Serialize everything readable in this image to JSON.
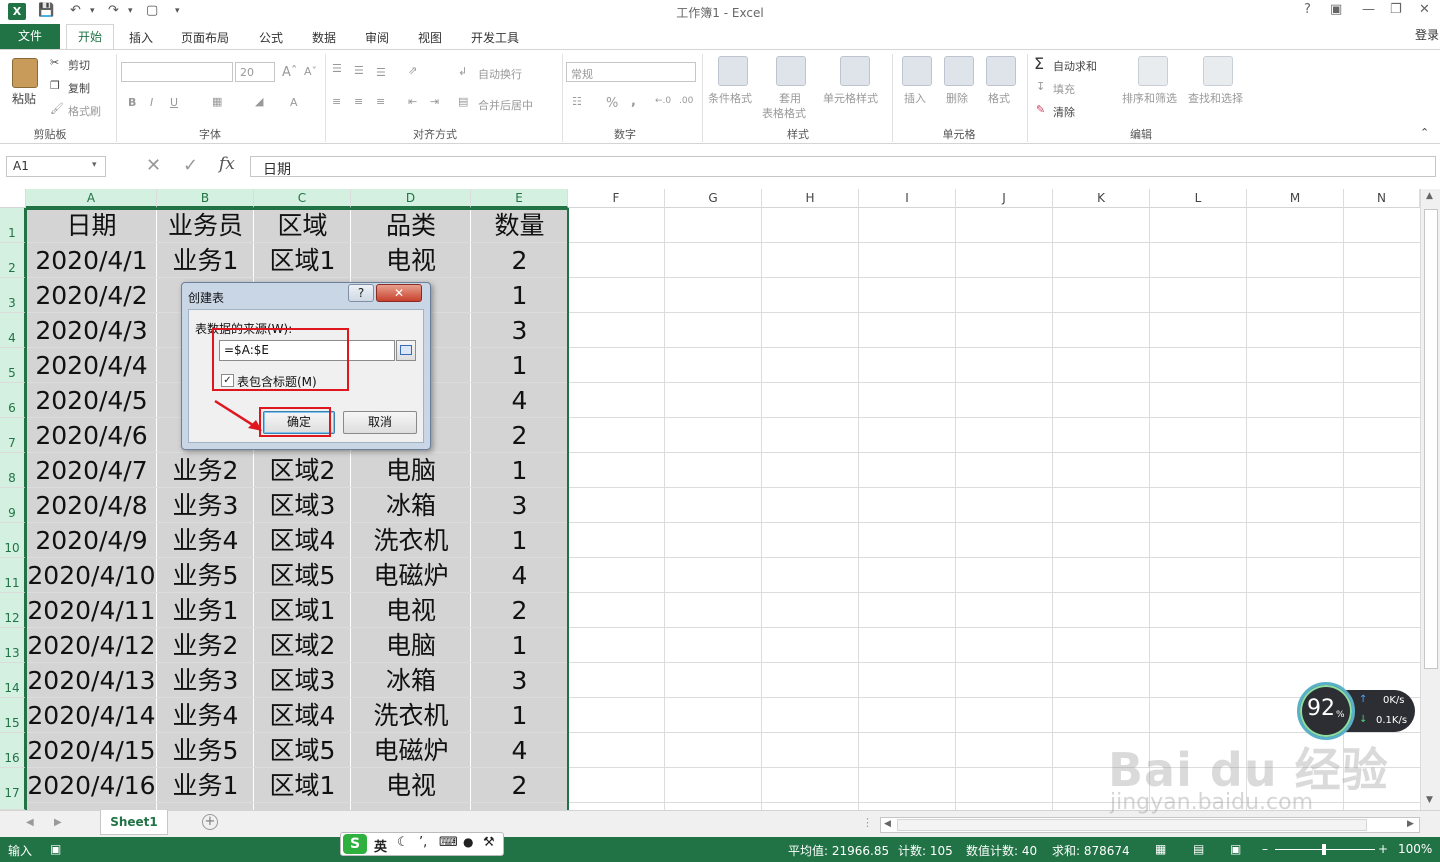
{
  "window": {
    "title": "工作簿1 - Excel",
    "login": "登录",
    "help": "?"
  },
  "tabs": [
    "文件",
    "开始",
    "插入",
    "页面布局",
    "公式",
    "数据",
    "审阅",
    "视图",
    "开发工具"
  ],
  "ribbon": {
    "clipboard": {
      "paste": "粘贴",
      "cut": "剪切",
      "copy": "复制",
      "format_painter": "格式刷",
      "label": "剪贴板"
    },
    "font": {
      "size": "20",
      "bold": "B",
      "italic": "I",
      "underline": "U",
      "label": "字体"
    },
    "align": {
      "wrap": "自动换行",
      "merge": "合并后居中",
      "label": "对齐方式"
    },
    "number": {
      "format": "常规",
      "percent": "%",
      "comma": ",",
      "label": "数字"
    },
    "styles": {
      "conditional": "条件格式",
      "table_a": "套用",
      "table_b": "表格格式",
      "cell_styles": "单元格样式",
      "label": "样式"
    },
    "cells": {
      "insert": "插入",
      "delete": "删除",
      "format": "格式",
      "label": "单元格"
    },
    "editing": {
      "autosum": "自动求和",
      "fill": "填充",
      "clear": "清除",
      "sort": "排序和筛选",
      "find": "查找和选择",
      "label": "编辑"
    }
  },
  "formula_bar": {
    "name_box": "A1",
    "fx": "fx",
    "value": "日期"
  },
  "columns": [
    "A",
    "B",
    "C",
    "D",
    "E",
    "F",
    "G",
    "H",
    "I",
    "J",
    "K",
    "L",
    "M",
    "N"
  ],
  "rows": [
    "1",
    "2",
    "3",
    "4",
    "5",
    "6",
    "7",
    "8",
    "9",
    "10",
    "11",
    "12",
    "13",
    "14",
    "15",
    "16",
    "17"
  ],
  "table": {
    "header": [
      "日期",
      "业务员",
      "区域",
      "品类",
      "数量"
    ],
    "rows": [
      [
        "2020/4/1",
        "业务1",
        "区域1",
        "电视",
        "2"
      ],
      [
        "2020/4/2",
        "",
        "",
        "",
        "1"
      ],
      [
        "2020/4/3",
        "",
        "",
        "",
        "3"
      ],
      [
        "2020/4/4",
        "",
        "",
        "",
        "1"
      ],
      [
        "2020/4/5",
        "",
        "",
        "",
        "4"
      ],
      [
        "2020/4/6",
        "",
        "",
        "",
        "2"
      ],
      [
        "2020/4/7",
        "业务2",
        "区域2",
        "电脑",
        "1"
      ],
      [
        "2020/4/8",
        "业务3",
        "区域3",
        "冰箱",
        "3"
      ],
      [
        "2020/4/9",
        "业务4",
        "区域4",
        "洗衣机",
        "1"
      ],
      [
        "2020/4/10",
        "业务5",
        "区域5",
        "电磁炉",
        "4"
      ],
      [
        "2020/4/11",
        "业务1",
        "区域1",
        "电视",
        "2"
      ],
      [
        "2020/4/12",
        "业务2",
        "区域2",
        "电脑",
        "1"
      ],
      [
        "2020/4/13",
        "业务3",
        "区域3",
        "冰箱",
        "3"
      ],
      [
        "2020/4/14",
        "业务4",
        "区域4",
        "洗衣机",
        "1"
      ],
      [
        "2020/4/15",
        "业务5",
        "区域5",
        "电磁炉",
        "4"
      ],
      [
        "2020/4/16",
        "业务1",
        "区域1",
        "电视",
        "2"
      ]
    ]
  },
  "dialog": {
    "title": "创建表",
    "help": "?",
    "close": "✕",
    "source_label": "表数据的来源(W):",
    "range": "=$A:$E",
    "has_header": "表包含标题(M)",
    "ok": "确定",
    "cancel": "取消"
  },
  "sheet": {
    "tab": "Sheet1",
    "add": "+"
  },
  "status": {
    "mode": "输入",
    "average": "平均值: 21966.85",
    "count": "计数: 105",
    "num_count": "数值计数: 40",
    "sum": "求和: 878674",
    "zoom": "100%"
  },
  "ime": {
    "lang": "英"
  },
  "speed": {
    "percent": "92",
    "unit": "%",
    "up": "0K/s",
    "down": "0.1K/s"
  },
  "watermark": {
    "brand": "Bai du 经验",
    "url": "jingyan.baidu.com"
  },
  "colors": {
    "excel_green": "#217346",
    "selection": "#d4d4d4",
    "annotation_red": "#e0161e"
  }
}
